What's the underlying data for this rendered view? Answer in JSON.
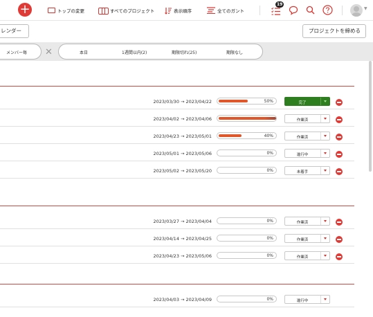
{
  "topbar": {
    "nav": [
      {
        "label": "トップの変更",
        "icon": "monitor-icon"
      },
      {
        "label": "すべてのプロジェクト",
        "icon": "folders-icon"
      },
      {
        "label": "表示順序",
        "icon": "sort-icon"
      },
      {
        "label": "全てのガント",
        "icon": "gantt-icon"
      }
    ],
    "notification_count": "19"
  },
  "toolbar": {
    "calendar_label": "レンダー",
    "close_project_label": "プロジェクトを締める"
  },
  "filters": {
    "group_label": "メンバー毎",
    "tabs": [
      "本日",
      "1週間以内(2)",
      "期限切れ(25)",
      "期限なし"
    ]
  },
  "sections": [
    {
      "rows": [
        {
          "dates": "2023/03/30 → 2023/04/22",
          "progress": 50,
          "progress_label": "50%",
          "status": "完了",
          "done": true
        },
        {
          "dates": "2023/04/02 → 2023/04/06",
          "progress": 100,
          "progress_label": "",
          "status": "作業済",
          "done": false
        },
        {
          "dates": "2023/04/23 → 2023/05/01",
          "progress": 40,
          "progress_label": "40%",
          "status": "作業済",
          "done": false
        },
        {
          "dates": "2023/05/01 → 2023/05/06",
          "progress": 0,
          "progress_label": "0%",
          "status": "進行中",
          "done": false
        },
        {
          "dates": "2023/05/02 → 2023/05/20",
          "progress": 0,
          "progress_label": "0%",
          "status": "未着手",
          "done": false
        }
      ]
    },
    {
      "rows": [
        {
          "dates": "2023/03/27 → 2023/04/04",
          "progress": 0,
          "progress_label": "0%",
          "status": "作業済",
          "done": false
        },
        {
          "dates": "2023/04/14 → 2023/04/25",
          "progress": 0,
          "progress_label": "0%",
          "status": "作業済",
          "done": false
        },
        {
          "dates": "2023/04/23 → 2023/05/06",
          "progress": 0,
          "progress_label": "0%",
          "status": "作業済",
          "done": false
        }
      ]
    },
    {
      "rows": [
        {
          "dates": "2023/04/03 → 2023/04/09",
          "progress": 0,
          "progress_label": "0%",
          "status": "進行中",
          "done": false
        }
      ]
    }
  ],
  "colors": {
    "accent": "#e03a36",
    "progress": "#e2572a",
    "done": "#2e7d1f",
    "section_line": "#c94b43"
  }
}
